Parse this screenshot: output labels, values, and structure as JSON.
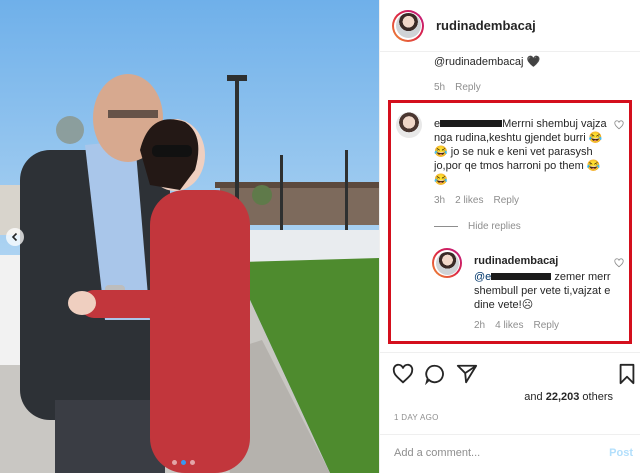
{
  "post": {
    "username": "rudinadembacaj",
    "previous_comment": {
      "text": "@rudinadembacaj 🖤",
      "time": "5h",
      "reply_label": "Reply"
    },
    "comment": {
      "text": "Merrni shembuj vajza nga rudina,keshtu gjendet burri 😂😂 jo se nuk e keni vet parasysh jo,por qe tmos harroni po them 😂😂",
      "time": "3h",
      "likes": "2 likes",
      "reply_label": "Reply"
    },
    "hide_replies_label": "Hide replies",
    "reply": {
      "username": "rudinadembacaj",
      "mention_prefix": "@",
      "text": "zemer merr shembull per vete ti,vajzat e dine vete!☹",
      "time": "2h",
      "likes": "4 likes",
      "reply_label": "Reply"
    },
    "likes_prefix": "and",
    "likes_count": "22,203",
    "likes_suffix": "others",
    "time_ago": "1 DAY AGO",
    "add_comment_placeholder": "Add a comment...",
    "post_label": "Post"
  },
  "icons": {
    "header_avatar": "avatar",
    "like": "heart-icon",
    "comment": "comment-icon",
    "share": "share-icon",
    "save": "bookmark-icon",
    "carousel_prev": "chevron-left-icon"
  },
  "colors": {
    "highlight_box": "#d40f1d",
    "mention": "#00376b",
    "muted": "#8e8e8e",
    "post_disabled": "#b2dffc",
    "carousel_active": "#3897f0"
  }
}
